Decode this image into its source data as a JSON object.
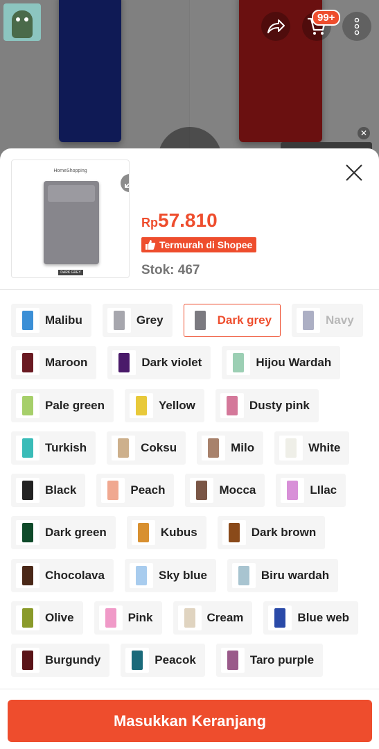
{
  "header": {
    "cart_badge": "99+"
  },
  "product": {
    "image_brand": "HomeShopping",
    "image_tag": "DARK GREY",
    "price_currency": "Rp",
    "price_amount": "57.810",
    "badge": "Termurah di Shopee",
    "stock": "Stok: 467"
  },
  "variants": [
    [
      {
        "label": "Malibu",
        "color": "#3b8fd6",
        "state": "normal"
      },
      {
        "label": "Grey",
        "color": "#a6a6ad",
        "state": "normal"
      },
      {
        "label": "Dark grey",
        "color": "#7b7a80",
        "state": "selected"
      },
      {
        "label": "Navy",
        "color": "#5a5f8a",
        "state": "disabled"
      }
    ],
    [
      {
        "label": "Maroon",
        "color": "#6a1a22",
        "state": "normal"
      },
      {
        "label": "Dark violet",
        "color": "#4a1a6a",
        "state": "normal"
      },
      {
        "label": "Hijou Wardah",
        "color": "#9ccfb4",
        "state": "normal"
      }
    ],
    [
      {
        "label": "Pale green",
        "color": "#a6cf6a",
        "state": "normal"
      },
      {
        "label": "Yellow",
        "color": "#e8c93a",
        "state": "normal"
      },
      {
        "label": "Dusty pink",
        "color": "#d4789a",
        "state": "normal"
      }
    ],
    [
      {
        "label": "Turkish",
        "color": "#3abcb8",
        "state": "normal"
      },
      {
        "label": "Coksu",
        "color": "#cdb08c",
        "state": "normal"
      },
      {
        "label": "Milo",
        "color": "#a8826c",
        "state": "normal"
      },
      {
        "label": "White",
        "color": "#efefe8",
        "state": "normal"
      }
    ],
    [
      {
        "label": "Black",
        "color": "#222222",
        "state": "normal"
      },
      {
        "label": "Peach",
        "color": "#f0a890",
        "state": "normal"
      },
      {
        "label": "Mocca",
        "color": "#7a5646",
        "state": "normal"
      },
      {
        "label": "LIlac",
        "color": "#d890d8",
        "state": "normal"
      }
    ],
    [
      {
        "label": "Dark green",
        "color": "#0f4a2a",
        "state": "normal"
      },
      {
        "label": "Kubus",
        "color": "#d89030",
        "state": "normal"
      },
      {
        "label": "Dark brown",
        "color": "#8a4a1a",
        "state": "normal"
      }
    ],
    [
      {
        "label": "Chocolava",
        "color": "#4a2818",
        "state": "normal"
      },
      {
        "label": "Sky blue",
        "color": "#a8ccee",
        "state": "normal"
      },
      {
        "label": "Biru wardah",
        "color": "#a8c4d0",
        "state": "normal"
      }
    ],
    [
      {
        "label": "Olive",
        "color": "#8a9a2a",
        "state": "normal"
      },
      {
        "label": "Pink",
        "color": "#f09ac8",
        "state": "normal"
      },
      {
        "label": "Cream",
        "color": "#e0d4c0",
        "state": "normal"
      },
      {
        "label": "Blue web",
        "color": "#2a4aa8",
        "state": "normal"
      }
    ],
    [
      {
        "label": "Burgundy",
        "color": "#5a1418",
        "state": "normal"
      },
      {
        "label": "Peacok",
        "color": "#1a6a7a",
        "state": "normal"
      },
      {
        "label": "Taro purple",
        "color": "#9a5a8a",
        "state": "normal"
      }
    ]
  ],
  "footer": {
    "add_to_cart": "Masukkan Keranjang"
  }
}
